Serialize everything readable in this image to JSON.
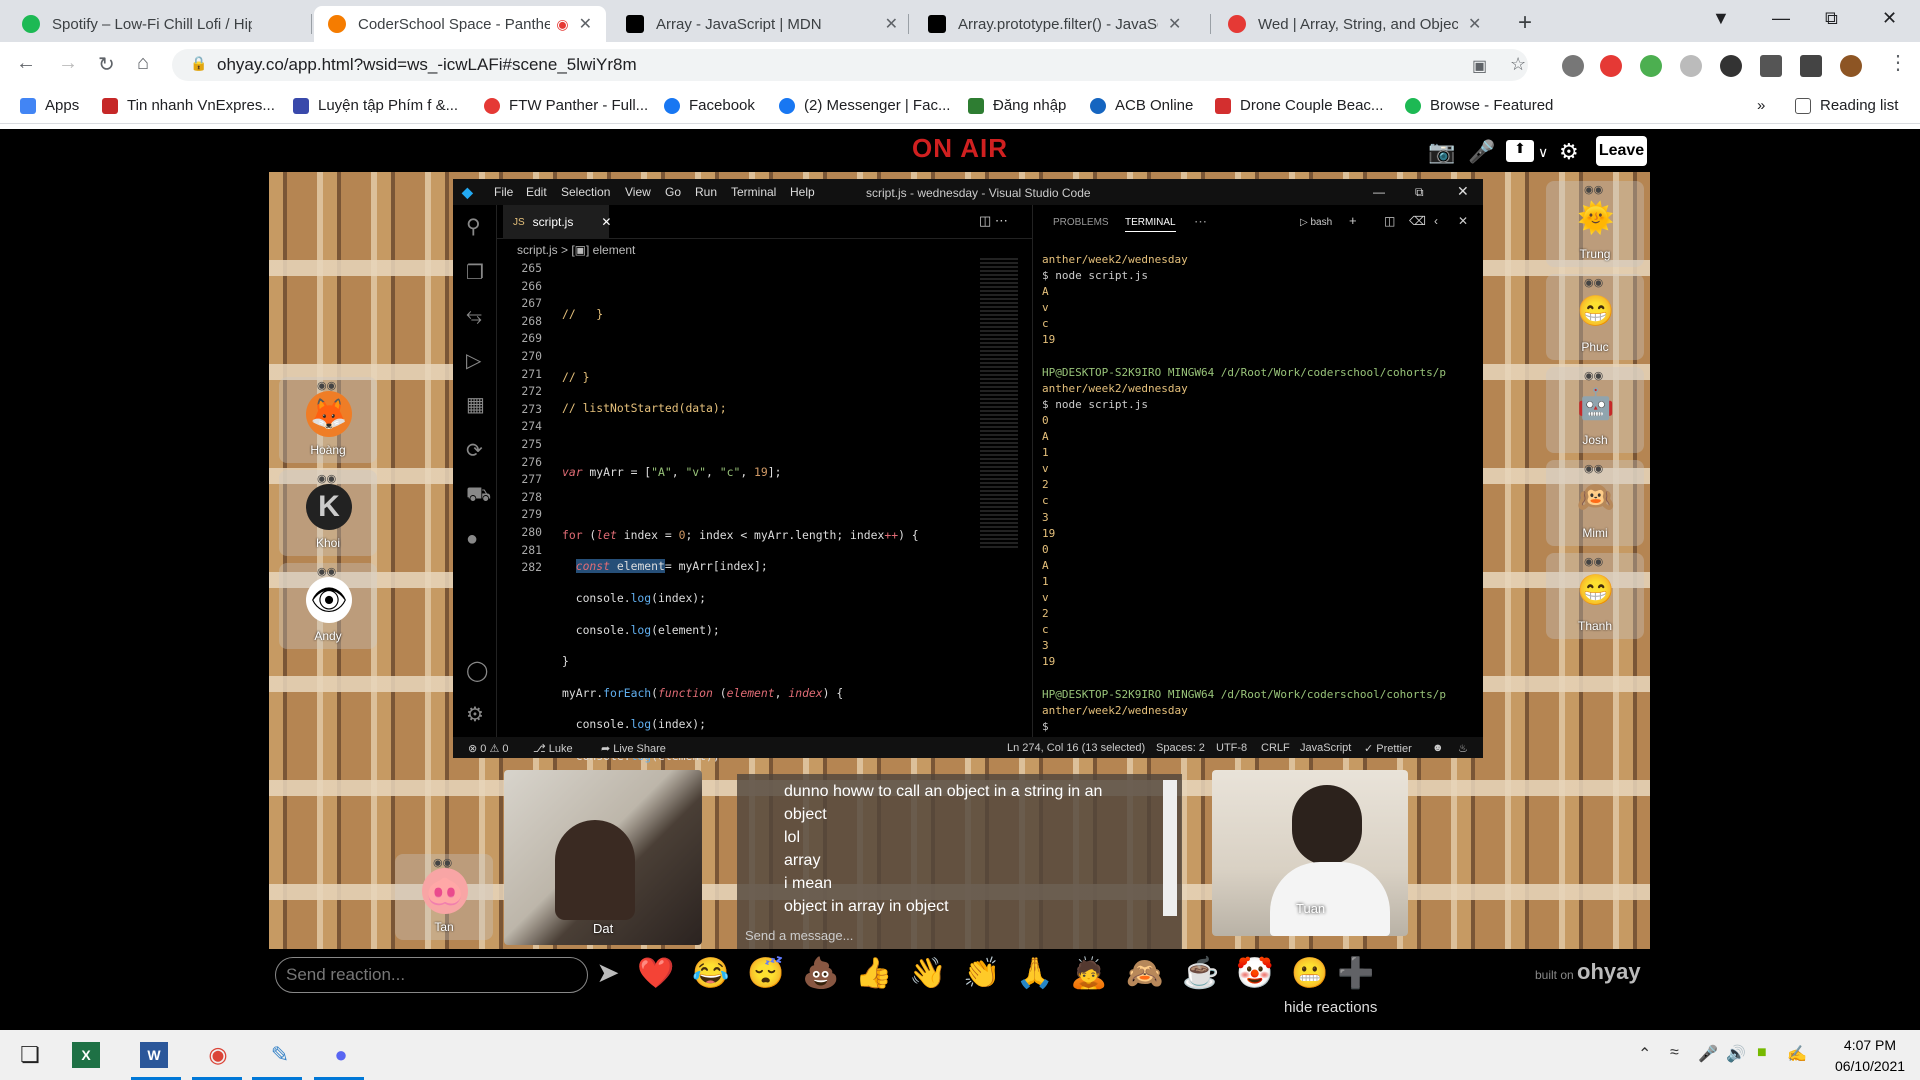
{
  "browser": {
    "tabs": [
      {
        "title": "Spotify – Low-Fi Chill Lofi / Hip-H",
        "color": "#1db954"
      },
      {
        "title": "CoderSchool Space - Panthe",
        "color": "#f57c00"
      },
      {
        "title": "Array - JavaScript | MDN",
        "color": "#000000"
      },
      {
        "title": "Array.prototype.filter() - JavaScrip",
        "color": "#000000"
      },
      {
        "title": "Wed | Array, String, and Object :",
        "color": "#e53935"
      }
    ],
    "url": "ohyay.co/app.html?wsid=ws_-icwLAFi#scene_5lwiYr8m",
    "bookmarks": [
      {
        "label": "Apps",
        "color": "#4285f4"
      },
      {
        "label": "Tin nhanh VnExpres...",
        "color": "#c62828"
      },
      {
        "label": "Luyện tập Phím f &...",
        "color": "#3949ab"
      },
      {
        "label": "FTW Panther - Full...",
        "color": "#e53935"
      },
      {
        "label": "Facebook",
        "color": "#1877f2"
      },
      {
        "label": "(2) Messenger | Fac...",
        "color": "#1877f2"
      },
      {
        "label": "Đăng nhập",
        "color": "#2e7d32"
      },
      {
        "label": "ACB Online",
        "color": "#1565c0"
      },
      {
        "label": "Drone Couple Beac...",
        "color": "#d32f2f"
      },
      {
        "label": "Browse - Featured",
        "color": "#1db954"
      }
    ],
    "reading_list": "Reading list"
  },
  "app": {
    "on_air": "ON AIR",
    "leave": "Leave",
    "vscode": {
      "menu": [
        "File",
        "Edit",
        "Selection",
        "View",
        "Go",
        "Run",
        "Terminal",
        "Help"
      ],
      "window_title": "script.js - wednesday - Visual Studio Code",
      "tab": "script.js",
      "breadcrumb": "script.js > [▣] element",
      "line_numbers": [
        "265",
        "266",
        "267",
        "268",
        "269",
        "270",
        "271",
        "272",
        "273",
        "274",
        "275",
        "276",
        "277",
        "278",
        "279",
        "280",
        "281",
        "282"
      ],
      "panel_tabs": [
        "PROBLEMS",
        "TERMINAL"
      ],
      "shell": "bash",
      "terminal": [
        "anther/week2/wednesday",
        "$ node script.js",
        "A",
        "v",
        "c",
        "19",
        "",
        "HP@DESKTOP-S2K9IRO MINGW64 /d/Root/Work/coderschool/cohorts/p",
        "anther/week2/wednesday",
        "$ node script.js",
        "0",
        "A",
        "1",
        "v",
        "2",
        "c",
        "3",
        "19",
        "0",
        "A",
        "1",
        "v",
        "2",
        "c",
        "3",
        "19",
        "",
        "HP@DESKTOP-S2K9IRO MINGW64 /d/Root/Work/coderschool/cohorts/p",
        "anther/week2/wednesday",
        "$ "
      ],
      "status": {
        "errors": "⊗ 0 ⚠ 0",
        "user": "Luke",
        "live_share": "Live Share",
        "position": "Ln 274, Col 16 (13 selected)",
        "spaces": "Spaces: 2",
        "encoding": "UTF-8",
        "eol": "CRLF",
        "language": "JavaScript",
        "formatter": "✓ Prettier"
      }
    },
    "participants_left": [
      {
        "name": "Hoàng",
        "emoji": "🦊"
      },
      {
        "name": "Khoi",
        "emoji": "K"
      },
      {
        "name": "Andy",
        "emoji": "👁"
      }
    ],
    "participants_right": [
      {
        "name": "Trung",
        "emoji": "🌞"
      },
      {
        "name": "Phuc",
        "emoji": "😁"
      },
      {
        "name": "Josh",
        "emoji": "🤖"
      },
      {
        "name": "Mimi",
        "emoji": "🙉"
      },
      {
        "name": "Thanh",
        "emoji": "😁"
      }
    ],
    "tan": {
      "name": "Tan",
      "emoji": "🐽"
    },
    "video_dat": "Dat",
    "video_tuan": "Tuan",
    "chat": {
      "messages": [
        "dunno howw to call an object in a string in an",
        "object",
        "lol",
        "array",
        "i mean",
        "object in array in object"
      ],
      "placeholder": "Send a message..."
    },
    "reaction_placeholder": "Send reaction...",
    "emojis": [
      "❤️",
      "😂",
      "😴",
      "💩",
      "👍",
      "👋",
      "👏",
      "🙏",
      "🙇",
      "🙈",
      "☕",
      "🤡",
      "😬",
      "➕"
    ],
    "hide_reactions": "hide reactions",
    "built_on": "built on",
    "brand": "ohyay"
  },
  "taskbar": {
    "time": "4:07 PM",
    "date": "06/10/2021"
  }
}
